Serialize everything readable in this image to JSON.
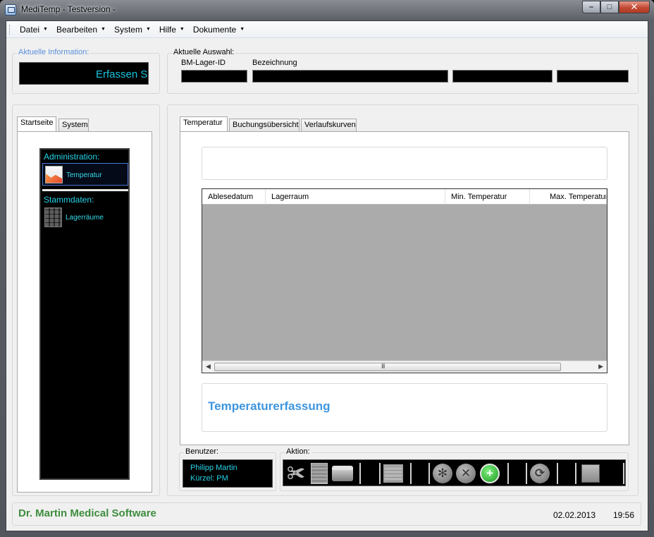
{
  "window": {
    "title": "MediTemp - Testversion -",
    "controls": [
      "–",
      "□",
      "✕"
    ]
  },
  "menu": [
    "Datei",
    "Bearbeiten",
    "System",
    "Hilfe",
    "Dokumente"
  ],
  "info": {
    "legend": "Aktuelle Information:",
    "display_text": "Erfassen Si"
  },
  "selection": {
    "legend": "Aktuelle Auswahl:",
    "label_id": "BM-Lager-ID",
    "label_name": "Bezeichnung"
  },
  "nav": {
    "tabs": [
      "Startseite",
      "System"
    ],
    "sections": [
      {
        "heading": "Administration:",
        "items": [
          {
            "label": "Temperatur",
            "icon": "temperature-chart-icon"
          }
        ]
      },
      {
        "heading": "Stammdaten:",
        "items": [
          {
            "label": "Lagerräume",
            "icon": "storage-rack-icon"
          }
        ]
      }
    ]
  },
  "main": {
    "tabs": [
      "Temperatur",
      "Buchungsübersicht",
      "Verlaufskurven"
    ],
    "grid": {
      "columns": [
        "Ablesedatum",
        "Lagerraum",
        "Min. Temperatur",
        "Max. Temperatur"
      ],
      "rows": []
    },
    "caption": "Temperaturerfassung"
  },
  "user": {
    "legend": "Benutzer:",
    "name": "Philipp Martin",
    "short": "Kürzel: PM"
  },
  "actions": {
    "legend": "Aktion:"
  },
  "status": {
    "brand": "Dr. Martin Medical Software",
    "date": "02.02.2013",
    "time": "19:56"
  },
  "colors": {
    "accent_cyan": "#26d3e8",
    "caption_blue": "#3d96e0",
    "brand_green": "#3e8d3e"
  }
}
